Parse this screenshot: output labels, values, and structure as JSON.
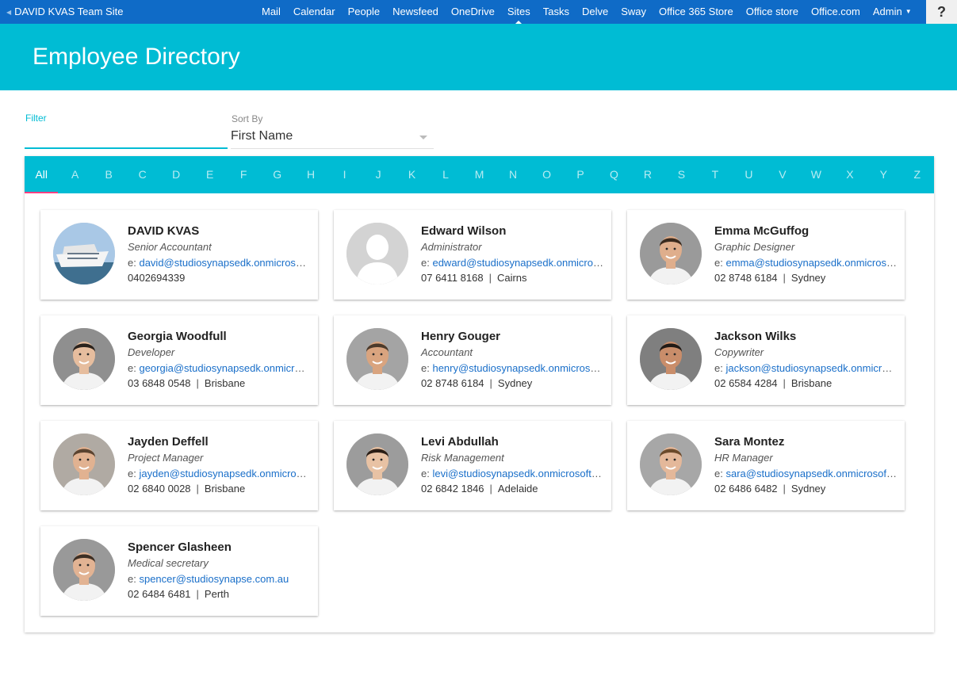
{
  "suitebar": {
    "site_title": "DAVID KVAS Team Site",
    "nav": [
      "Mail",
      "Calendar",
      "People",
      "Newsfeed",
      "OneDrive",
      "Sites",
      "Tasks",
      "Delve",
      "Sway",
      "Office 365 Store",
      "Office store",
      "Office.com",
      "Admin"
    ],
    "active_nav": "Sites",
    "help_label": "?"
  },
  "header": {
    "title": "Employee Directory"
  },
  "filter": {
    "label": "Filter",
    "value": ""
  },
  "sort": {
    "label": "Sort By",
    "value": "First Name"
  },
  "alphabet": [
    "All",
    "A",
    "B",
    "C",
    "D",
    "E",
    "F",
    "G",
    "H",
    "I",
    "J",
    "K",
    "L",
    "M",
    "N",
    "O",
    "P",
    "Q",
    "R",
    "S",
    "T",
    "U",
    "V",
    "W",
    "X",
    "Y",
    "Z"
  ],
  "active_letter": "All",
  "colors": {
    "accent": "#00bcd4",
    "suitebar": "#0f6bc7",
    "link": "#1a6fc9",
    "tab_indicator": "#ff4081"
  },
  "employees": [
    {
      "name": "DAVID KVAS",
      "title": "Senior Accountant",
      "email_prefix": "e:",
      "email": "david@studiosynapsedk.onmicrosoft.com",
      "phone": "0402694339",
      "location": "",
      "photo": "ship-photo"
    },
    {
      "name": "Edward Wilson",
      "title": "Administrator",
      "email_prefix": "e:",
      "email": "edward@studiosynapsedk.onmicrosoft.com",
      "phone": "07 6411 8168",
      "location": "Cairns",
      "photo": "placeholder-silhouette"
    },
    {
      "name": "Emma McGuffog",
      "title": "Graphic Designer",
      "email_prefix": "e:",
      "email": "emma@studiosynapsedk.onmicrosoft.com",
      "phone": "02 8748 6184",
      "location": "Sydney",
      "photo": "person-photo"
    },
    {
      "name": "Georgia Woodfull",
      "title": "Developer",
      "email_prefix": "e:",
      "email": "georgia@studiosynapsedk.onmicrosoft.com",
      "phone": "03 6848 0548",
      "location": "Brisbane",
      "photo": "person-photo"
    },
    {
      "name": "Henry Gouger",
      "title": "Accountant",
      "email_prefix": "e:",
      "email": "henry@studiosynapsedk.onmicrosoft.com",
      "phone": "02 8748 6184",
      "location": "Sydney",
      "photo": "person-photo"
    },
    {
      "name": "Jackson Wilks",
      "title": "Copywriter",
      "email_prefix": "e:",
      "email": "jackson@studiosynapsedk.onmicrosoft.com",
      "phone": "02 6584 4284",
      "location": "Brisbane",
      "photo": "person-photo"
    },
    {
      "name": "Jayden Deffell",
      "title": "Project Manager",
      "email_prefix": "e:",
      "email": "jayden@studiosynapsedk.onmicrosoft.com",
      "phone": "02 6840 0028",
      "location": "Brisbane",
      "photo": "person-photo"
    },
    {
      "name": "Levi Abdullah",
      "title": "Risk Management",
      "email_prefix": "e:",
      "email": "levi@studiosynapsedk.onmicrosoft.com",
      "phone": "02 6842 1846",
      "location": "Adelaide",
      "photo": "person-photo"
    },
    {
      "name": "Sara Montez",
      "title": "HR Manager",
      "email_prefix": "e:",
      "email": "sara@studiosynapsedk.onmicrosoft.com",
      "phone": "02 6486 6482",
      "location": "Sydney",
      "photo": "person-photo"
    },
    {
      "name": "Spencer Glasheen",
      "title": "Medical secretary",
      "email_prefix": "e:",
      "email": "spencer@studiosynapse.com.au",
      "phone": "02 6484 6481",
      "location": "Perth",
      "photo": "person-photo"
    }
  ]
}
